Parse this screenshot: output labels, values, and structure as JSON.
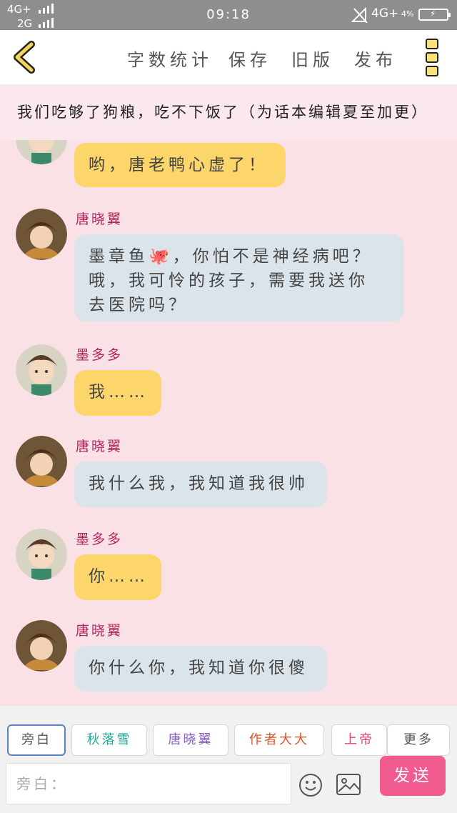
{
  "status_bar": {
    "network_top": "4G+",
    "network_bottom": "2G",
    "time": "09:18",
    "network_right": "4G+",
    "battery_percent": "4%"
  },
  "toolbar": {
    "word_count": "字数统计",
    "save": "保存",
    "old_version": "旧版",
    "publish": "发布"
  },
  "story_title": "我们吃够了狗粮，吃不下饭了（为话本编辑夏至加更）",
  "messages": [
    {
      "speaker": "",
      "text": "哟，唐老鸭心虚了！",
      "style": "yellow"
    },
    {
      "speaker": "唐晓翼",
      "line1": "墨章鱼🐙，你怕不是神经病吧？",
      "line2": "哦，我可怜的孩子，需要我送你",
      "line3": "去医院吗？",
      "style": "blue"
    },
    {
      "speaker": "墨多多",
      "text": "我……",
      "style": "yellow"
    },
    {
      "speaker": "唐晓翼",
      "text": "我什么我，我知道我很帅",
      "style": "blue"
    },
    {
      "speaker": "墨多多",
      "text": "你……",
      "style": "yellow"
    },
    {
      "speaker": "唐晓翼",
      "text": "你什么你，我知道你很傻",
      "style": "blue"
    }
  ],
  "roles": [
    {
      "label": "旁白",
      "color": "#555555"
    },
    {
      "label": "秋落雪",
      "color": "#23a89a"
    },
    {
      "label": "唐晓翼",
      "color": "#8a5ec4"
    },
    {
      "label": "作者大大",
      "color": "#d9532b"
    },
    {
      "label": "上帝",
      "color": "#e0476f"
    },
    {
      "label": "更多",
      "color": "#555555"
    }
  ],
  "input": {
    "prefix": "旁白："
  },
  "send_label": "发送",
  "colors": {
    "background": "#f9e1e6",
    "yellow_bubble": "#fdd66b",
    "blue_bubble": "#dbe4ea",
    "speaker_name": "#b4235c",
    "send_button": "#f25b8f",
    "accent_icon": "#f1d65a"
  }
}
